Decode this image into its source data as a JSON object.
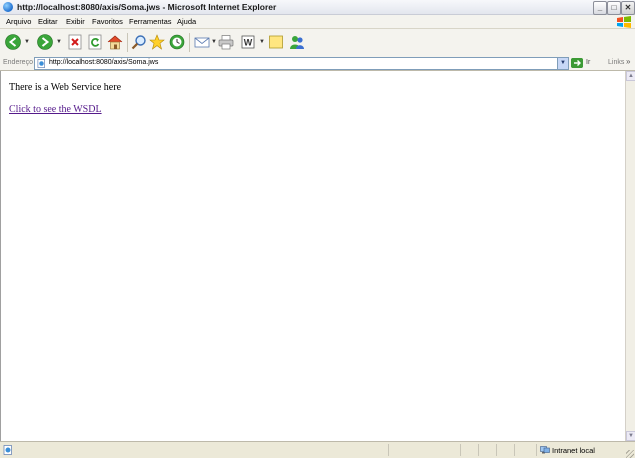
{
  "window": {
    "title": "http://localhost:8080/axis/Soma.jws - Microsoft Internet Explorer",
    "controls": {
      "minimize": "_",
      "maximize": "□",
      "close": "✕"
    }
  },
  "menu": [
    "Arquivo",
    "Editar",
    "Exibir",
    "Favoritos",
    "Ferramentas",
    "Ajuda"
  ],
  "toolbar": {
    "icons": [
      "back-icon",
      "forward-icon",
      "stop-icon",
      "refresh-icon",
      "home-icon",
      "search-icon",
      "favorites-icon",
      "history-icon",
      "mail-icon",
      "print-icon",
      "edit-icon",
      "discuss-icon",
      "messenger-icon"
    ]
  },
  "address": {
    "label": "Endereço",
    "url": "http://localhost:8080/axis/Soma.jws",
    "go_label": "Ir",
    "links_label": "Links"
  },
  "content": {
    "text": "There is a Web Service here",
    "link_text": "Click to see the WSDL"
  },
  "status": {
    "zone_label": "Intranet local"
  },
  "colors": {
    "link_visited": "#551a8b",
    "chrome_bg": "#ece9d8",
    "address_border": "#7f9db9"
  }
}
